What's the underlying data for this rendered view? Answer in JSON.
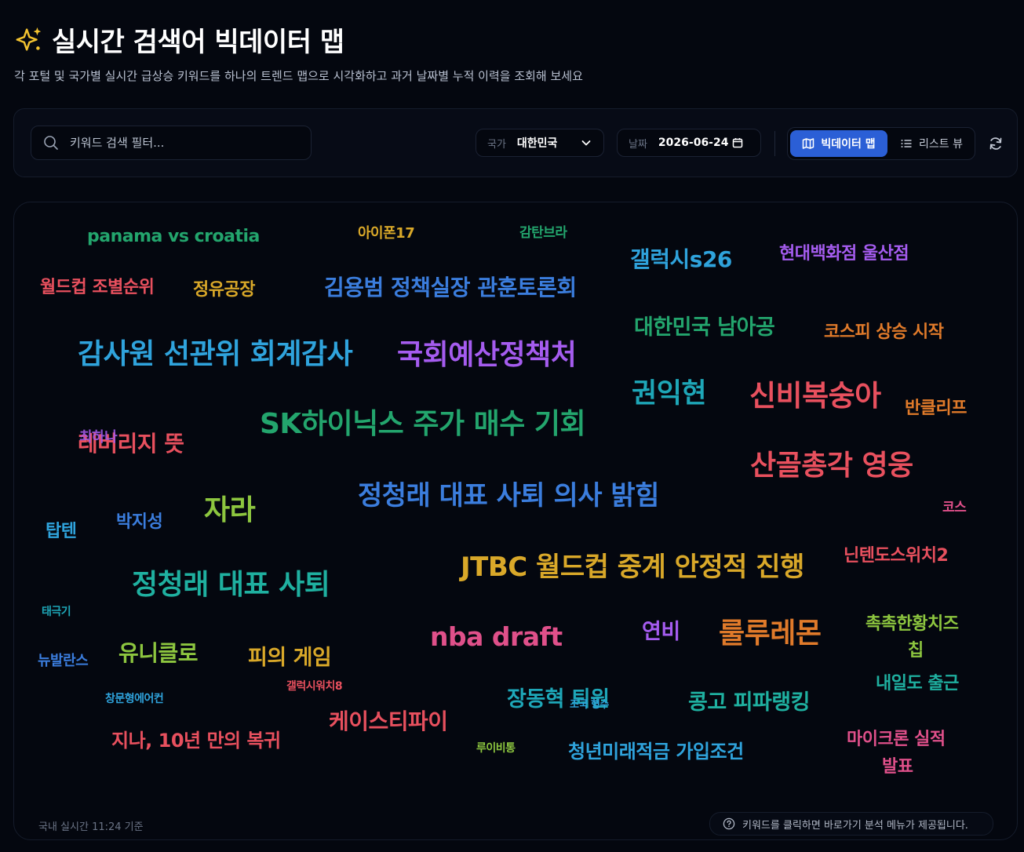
{
  "header": {
    "title": "실시간 검색어 빅데이터 맵",
    "subtitle": "각 포털 및 국가별 실시간 급상승 키워드를 하나의 트렌드 맵으로 시각화하고 과거 날짜별 누적 이력을 조회해 보세요",
    "icon": "sparkle-icon"
  },
  "toolbar": {
    "search_placeholder": "키워드 검색 필터...",
    "country_label": "국가",
    "country_value": "대한민국",
    "date_label": "날짜",
    "date_value": "2026-06-24",
    "map_view_label": "빅데이터 맵",
    "list_view_label": "리스트 뷰",
    "active_view": "map"
  },
  "keywords": [
    {
      "text": "panama vs croatia",
      "color": "#23a56d"
    },
    {
      "text": "아이폰17",
      "color": "#d9a829"
    },
    {
      "text": "감탄브라",
      "color": "#23a56d"
    },
    {
      "text": "갤럭시s26",
      "color": "#2fa3dc"
    },
    {
      "text": "현대백화점 울산점",
      "color": "#a55cef"
    },
    {
      "text": "월드컵 조별순위",
      "color": "#e8505e"
    },
    {
      "text": "정유공장",
      "color": "#d9a829"
    },
    {
      "text": "김용범 정책실장 관훈토론회",
      "color": "#3b7ddd"
    },
    {
      "text": "대한민국 남아공",
      "color": "#23a56d"
    },
    {
      "text": "코스피 상승 시작",
      "color": "#e07a2a"
    },
    {
      "text": "감사원 선관위 회계감사",
      "color": "#2fa3dc"
    },
    {
      "text": "국회예산정책처",
      "color": "#a55cef"
    },
    {
      "text": "권익현",
      "color": "#1ea7b8"
    },
    {
      "text": "신비복숭아",
      "color": "#e8505e"
    },
    {
      "text": "반클리프",
      "color": "#e07a2a"
    },
    {
      "text": "SK하이닉스 주가 매수 기회",
      "color": "#23a56d"
    },
    {
      "text": "레버리지 뜻",
      "color": "#e8505e"
    },
    {
      "text": "최하나",
      "color": "#a55cef"
    },
    {
      "text": "산골총각 영웅",
      "color": "#e8505e"
    },
    {
      "text": "자라",
      "color": "#8dc63f"
    },
    {
      "text": "정청래 대표 사퇴 의사 밝힘",
      "color": "#3b7ddd"
    },
    {
      "text": "코스",
      "color": "#e0508a"
    },
    {
      "text": "탑텐",
      "color": "#2fa3dc"
    },
    {
      "text": "박지성",
      "color": "#3b7ddd"
    },
    {
      "text": "닌텐도스위치2",
      "color": "#e8505e"
    },
    {
      "text": "정청래 대표 사퇴",
      "color": "#1fb0a0"
    },
    {
      "text": "JTBC 월드컵 중계 안정적 진행",
      "color": "#d9a829"
    },
    {
      "text": "태극기",
      "color": "#1ea7b8"
    },
    {
      "text": "nba draft",
      "color": "#e0508a"
    },
    {
      "text": "연비",
      "color": "#a55cef"
    },
    {
      "text": "룰루레몬",
      "color": "#e07a2a"
    },
    {
      "text": "촉촉한황치즈",
      "color": "#8dc63f"
    },
    {
      "text": "칩",
      "color": "#8dc63f"
    },
    {
      "text": "유니클로",
      "color": "#8dc63f"
    },
    {
      "text": "피의 게임",
      "color": "#d9a829"
    },
    {
      "text": "뉴발란스",
      "color": "#3b7ddd"
    },
    {
      "text": "내일도 출근",
      "color": "#1fb0a0"
    },
    {
      "text": "갤럭시워치8",
      "color": "#e8505e"
    },
    {
      "text": "창문형에어컨",
      "color": "#2fa3dc"
    },
    {
      "text": "장동혁 퇴원",
      "color": "#1ea7b8"
    },
    {
      "text": "조국 형수",
      "color": "#2fa3dc"
    },
    {
      "text": "콩고 피파랭킹",
      "color": "#1fb0a0"
    },
    {
      "text": "케이스티파이",
      "color": "#e8505e"
    },
    {
      "text": "지나, 10년 만의 복귀",
      "color": "#e8505e"
    },
    {
      "text": "루이비통",
      "color": "#8dc63f"
    },
    {
      "text": "청년미래적금 가입조건",
      "color": "#2fa3dc"
    },
    {
      "text": "마이크론 실적",
      "color": "#e0508a"
    },
    {
      "text": "발표",
      "color": "#e0508a"
    }
  ],
  "footer": {
    "status": "국내 실시간 11:24 기준",
    "hint": "키워드를 클릭하면 바로가기 분석 메뉴가 제공됩니다."
  }
}
